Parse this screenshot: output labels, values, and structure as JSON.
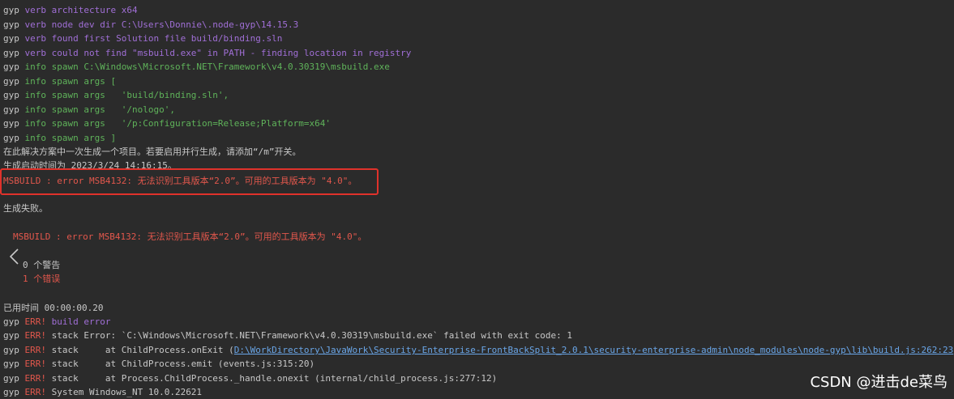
{
  "terminal": {
    "lines": [
      {
        "prefix": "gyp",
        "tag": "verb",
        "text": "architecture x64"
      },
      {
        "prefix": "gyp",
        "tag": "verb",
        "text": "node dev dir C:\\Users\\Donnie\\.node-gyp\\14.15.3"
      },
      {
        "prefix": "gyp",
        "tag": "verb",
        "text": "found first Solution file build/binding.sln"
      },
      {
        "prefix": "gyp",
        "tag": "verb",
        "text": "could not find \"msbuild.exe\" in PATH - finding location in registry"
      },
      {
        "prefix": "gyp",
        "tag": "info",
        "text": "spawn C:\\Windows\\Microsoft.NET\\Framework\\v4.0.30319\\msbuild.exe"
      },
      {
        "prefix": "gyp",
        "tag": "info",
        "text": "spawn args ["
      },
      {
        "prefix": "gyp",
        "tag": "info",
        "text": "spawn args   'build/binding.sln',"
      },
      {
        "prefix": "gyp",
        "tag": "info",
        "text": "spawn args   '/nologo',"
      },
      {
        "prefix": "gyp",
        "tag": "info",
        "text": "spawn args   '/p:Configuration=Release;Platform=x64'"
      },
      {
        "prefix": "gyp",
        "tag": "info",
        "text": "spawn args ]"
      }
    ],
    "msg_parallel": "在此解决方案中一次生成一个项目。若要启用并行生成，请添加“/m”开关。",
    "msg_build_start": "生成启动时间为 2023/3/24 14:16:15。",
    "msbuild_error": "MSBUILD : error MSB4132: 无法识别工具版本“2.0”。可用的工具版本为 \"4.0\"。",
    "build_failed": "生成失败。",
    "msbuild_error_indented": "MSBUILD : error MSB4132: 无法识别工具版本“2.0”。可用的工具版本为 \"4.0\"。",
    "warnings": "0 个警告",
    "errors": "1 个错误",
    "elapsed": "已用时间 00:00:00.20",
    "err_lines": [
      {
        "prefix": "gyp",
        "tag": "ERR!",
        "text": "build error"
      },
      {
        "prefix": "gyp",
        "tag": "ERR!",
        "text": "stack Error: `C:\\Windows\\Microsoft.NET\\Framework\\v4.0.30319\\msbuild.exe` failed with exit code: 1"
      },
      {
        "prefix": "gyp",
        "tag": "ERR!",
        "text": "stack     at ChildProcess.onExit (",
        "link": "D:\\WorkDirectory\\JavaWork\\Security-Enterprise-FrontBackSplit_2.0.1\\security-enterprise-admin\\node_modules\\node-gyp\\lib\\build.js:262:23",
        "tail": ")"
      },
      {
        "prefix": "gyp",
        "tag": "ERR!",
        "text": "stack     at ChildProcess.emit (events.js:315:20)"
      },
      {
        "prefix": "gyp",
        "tag": "ERR!",
        "text": "stack     at Process.ChildProcess._handle.onexit (internal/child_process.js:277:12)"
      },
      {
        "prefix": "gyp",
        "tag": "ERR!",
        "text": "System Windows_NT 10.0.22621"
      }
    ]
  },
  "watermark": "CSDN @进击de菜鸟",
  "colors": {
    "verb": "#a06fd6",
    "info": "#5fb35a",
    "error": "#e2574c",
    "highlight_box": "#e0322b"
  },
  "icons": {
    "collapse": "chevron-left-icon"
  }
}
